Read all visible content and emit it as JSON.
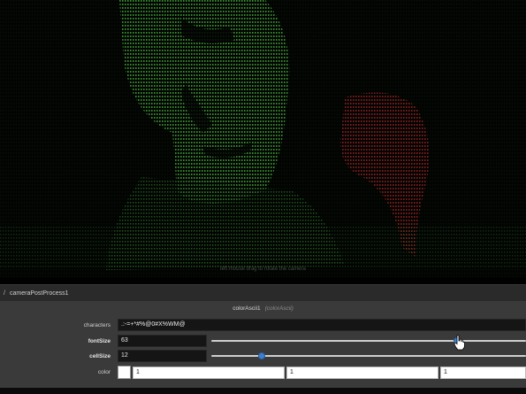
{
  "preview": {
    "caption": "left mouse drag to rotate the camera"
  },
  "breadcrumb": {
    "separator": "/",
    "path": "cameraPostProcess1"
  },
  "node": {
    "name": "colorAscii1",
    "type": "(colorAscii)"
  },
  "params": {
    "characters": {
      "label": "characters",
      "value": " .:-=+*#%@0#X%WM@"
    },
    "fontSize": {
      "label": "fontSize",
      "value": "63",
      "slider_fraction": 0.78
    },
    "cellSize": {
      "label": "cellSize",
      "value": "12",
      "slider_fraction": 0.16
    },
    "color": {
      "label": "color",
      "r": "1",
      "g": "1",
      "b": "1",
      "swatch": "#ffffff"
    }
  },
  "colors": {
    "ascii_green": "#2f7a2a",
    "ascii_red": "#7a1a1a",
    "slider_thumb": "#3d7ecf",
    "panel_bg": "#3a3a3a"
  },
  "icons": {
    "cursor": "hand-pointer-icon"
  }
}
